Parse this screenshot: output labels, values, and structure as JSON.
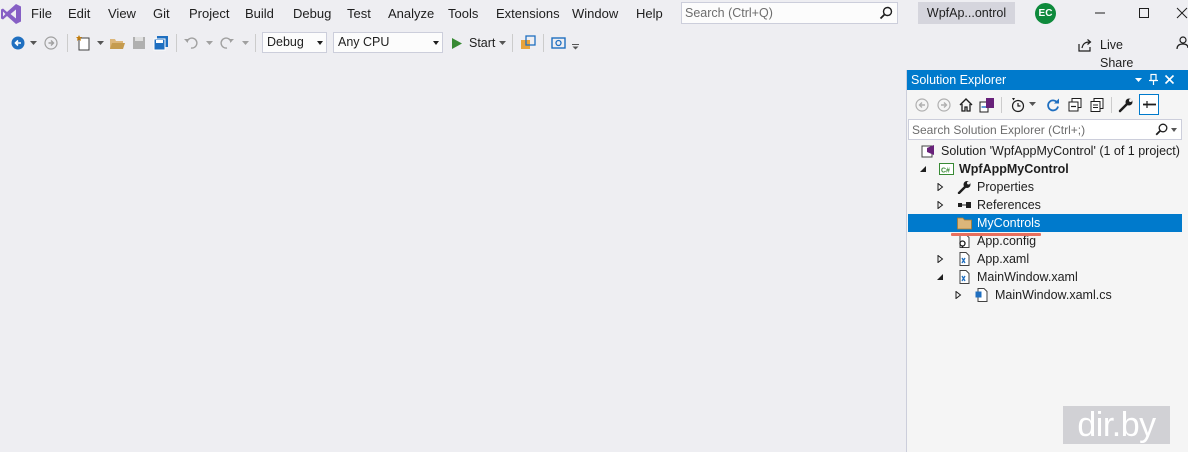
{
  "menu": {
    "items": [
      {
        "label": "File"
      },
      {
        "label": "Edit"
      },
      {
        "label": "View"
      },
      {
        "label": "Git"
      },
      {
        "label": "Project"
      },
      {
        "label": "Build"
      },
      {
        "label": "Debug"
      },
      {
        "label": "Test"
      },
      {
        "label": "Analyze"
      },
      {
        "label": "Tools"
      },
      {
        "label": "Extensions"
      },
      {
        "label": "Window"
      },
      {
        "label": "Help"
      }
    ],
    "search_placeholder": "Search (Ctrl+Q)",
    "solution_title": "WpfAp...ontrol",
    "avatar_initials": "EC"
  },
  "toolbar": {
    "config_value": "Debug",
    "platform_value": "Any CPU",
    "start_label": "Start",
    "live_share_label": "Live Share"
  },
  "solution_explorer": {
    "title": "Solution Explorer",
    "search_placeholder": "Search Solution Explorer (Ctrl+;)",
    "tree": [
      {
        "label": "Solution 'WpfAppMyControl' (1 of 1 project)",
        "icon": "solution-icon"
      },
      {
        "label": "WpfAppMyControl",
        "icon": "csharp-project-icon",
        "bold": true,
        "expanded": true
      },
      {
        "label": "Properties",
        "icon": "wrench-icon",
        "expanded": false
      },
      {
        "label": "References",
        "icon": "references-icon",
        "expanded": false
      },
      {
        "label": "MyControls",
        "icon": "folder-icon",
        "selected": true
      },
      {
        "label": "App.config",
        "icon": "config-file-icon"
      },
      {
        "label": "App.xaml",
        "icon": "xaml-file-icon",
        "expanded": false
      },
      {
        "label": "MainWindow.xaml",
        "icon": "xaml-file-icon",
        "expanded": true
      },
      {
        "label": "MainWindow.xaml.cs",
        "icon": "cs-file-icon",
        "expanded": false
      }
    ]
  },
  "colors": {
    "accent": "#007acc",
    "background": "#eeeef2",
    "annotation_underline": "#e86f5d"
  },
  "watermark": "dir.by"
}
